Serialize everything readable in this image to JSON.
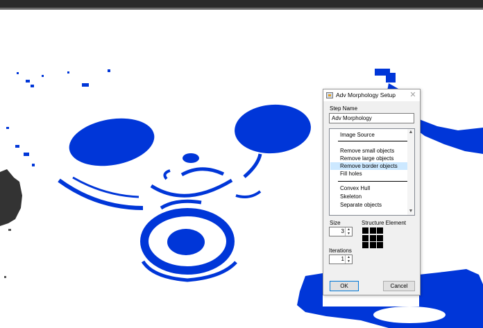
{
  "colors": {
    "segmentation_blue": "#0036d8",
    "selection_highlight": "#cce8ff"
  },
  "dialog": {
    "title": "Adv Morphology Setup",
    "close_icon": "close-icon",
    "step_name_label": "Step Name",
    "step_name_value": "Adv Morphology",
    "operations": [
      {
        "label": "Image Source",
        "selected": false
      },
      {
        "label": "Remove small objects",
        "selected": false
      },
      {
        "label": "Remove large objects",
        "selected": false
      },
      {
        "label": "Remove border objects",
        "selected": true
      },
      {
        "label": "Fill holes",
        "selected": false
      },
      {
        "label": "Convex Hull",
        "selected": false
      },
      {
        "label": "Skeleton",
        "selected": false
      },
      {
        "label": "Separate objects",
        "selected": false
      }
    ],
    "size_label": "Size",
    "size_value": "3",
    "structure_element_label": "Structure Element",
    "iterations_label": "Iterations",
    "iterations_value": "1",
    "ok_label": "OK",
    "cancel_label": "Cancel"
  }
}
